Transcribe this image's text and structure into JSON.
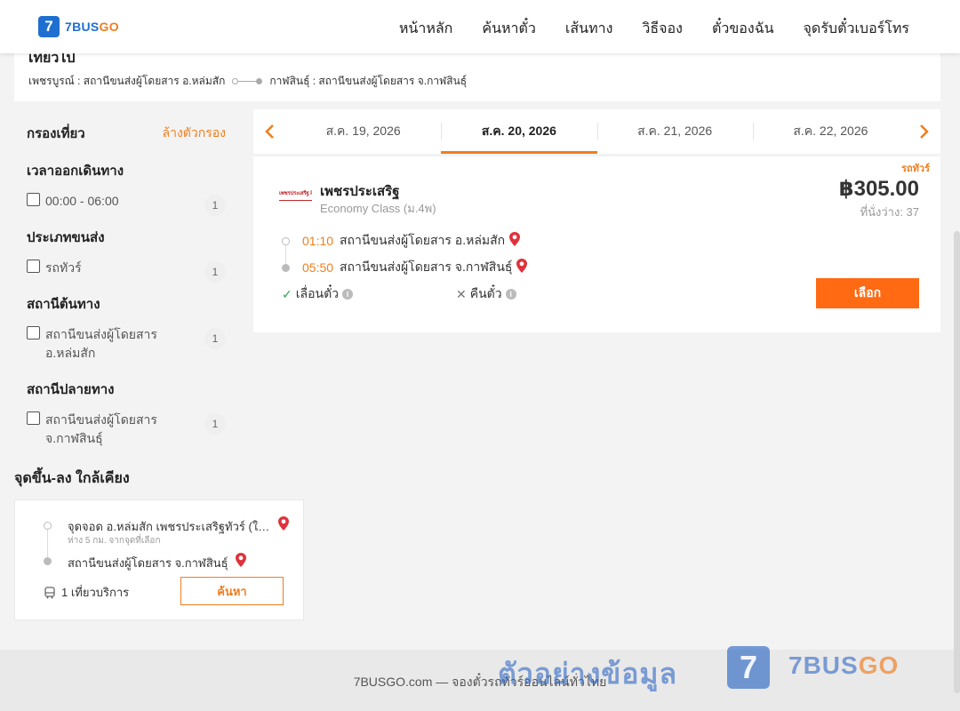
{
  "header": {
    "logo_mark": "7",
    "logo_brand": "7BUS",
    "logo_brand_go": "GO",
    "nav": [
      "หน้าหลัก",
      "ค้นหาตั๋ว",
      "เส้นทาง",
      "วิธีจอง",
      "ตั๋วของฉัน",
      "จุดรับตั๋วเบอร์โทร"
    ]
  },
  "trip": {
    "title": "เที่ยวไป",
    "from": "เพชรบูรณ์ : สถานีขนส่งผู้โดยสาร อ.หล่มสัก",
    "to": "กาฬสินธุ์ : สถานีขนส่งผู้โดยสาร จ.กาฬสินธุ์"
  },
  "filters": {
    "title": "กรองเที่ยว",
    "clear": "ล้างตัวกรอง",
    "groups": [
      {
        "title": "เวลาออกเดินทาง",
        "options": [
          {
            "label": "00:00 - 06:00",
            "count": "1"
          }
        ]
      },
      {
        "title": "ประเภทขนส่ง",
        "options": [
          {
            "label": "รถทัวร์",
            "count": "1"
          }
        ]
      },
      {
        "title": "สถานีต้นทาง",
        "options": [
          {
            "label": "สถานีขนส่งผู้โดยสาร อ.หล่มสัก",
            "count": "1"
          }
        ]
      },
      {
        "title": "สถานีปลายทาง",
        "options": [
          {
            "label": "สถานีขนส่งผู้โดยสาร จ.กาฬสินธุ์",
            "count": "1"
          }
        ]
      }
    ]
  },
  "dates": [
    "ส.ค. 19, 2026",
    "ส.ค. 20, 2026",
    "ส.ค. 21, 2026",
    "ส.ค. 22, 2026"
  ],
  "active_date_index": 1,
  "result": {
    "badge": "รถทัวร์",
    "operator_logo_text": "เพชรประเสริฐ PHETPRASERT",
    "operator": "เพชรประเสริฐ",
    "class": "Economy Class (ม.4พ)",
    "price": "฿305.00",
    "seats": "ที่นั่งว่าง: 37",
    "depart_time": "01:10",
    "depart_station": "สถานีขนส่งผู้โดยสาร อ.หล่มสัก",
    "arrive_time": "05:50",
    "arrive_station": "สถานีขนส่งผู้โดยสาร จ.กาฬสินธุ์",
    "reschedule": "เลื่อนตั๋ว",
    "refund": "คืนตั๋ว",
    "select": "เลือก"
  },
  "nearby": {
    "title": "จุดขึ้น-ลง ใกล้เคียง",
    "stop1": "จุดจอด อ.หล่มสัก เพชรประเสริฐทัวร์ (ใกล้ตลาด)",
    "stop1_note": "ห่าง 5 กม. จากจุดที่เลือก",
    "stop2": "สถานีขนส่งผู้โดยสาร จ.กาฬสินธุ์",
    "service": "1 เที่ยวบริการ",
    "search": "ค้นหา"
  },
  "footer": {
    "text": "7BUSGO.com — จองตั๋วรถทัวร์ออนไลน์ทั่วไทย"
  },
  "watermark": {
    "thai": "ตัวอย่างข้อมูล",
    "mark": "7",
    "brand": "7BUS",
    "brand_go": "GO"
  },
  "colors": {
    "accent": "#f07d1d",
    "button": "#ff6a13",
    "brand_blue": "#1f6fd1"
  }
}
